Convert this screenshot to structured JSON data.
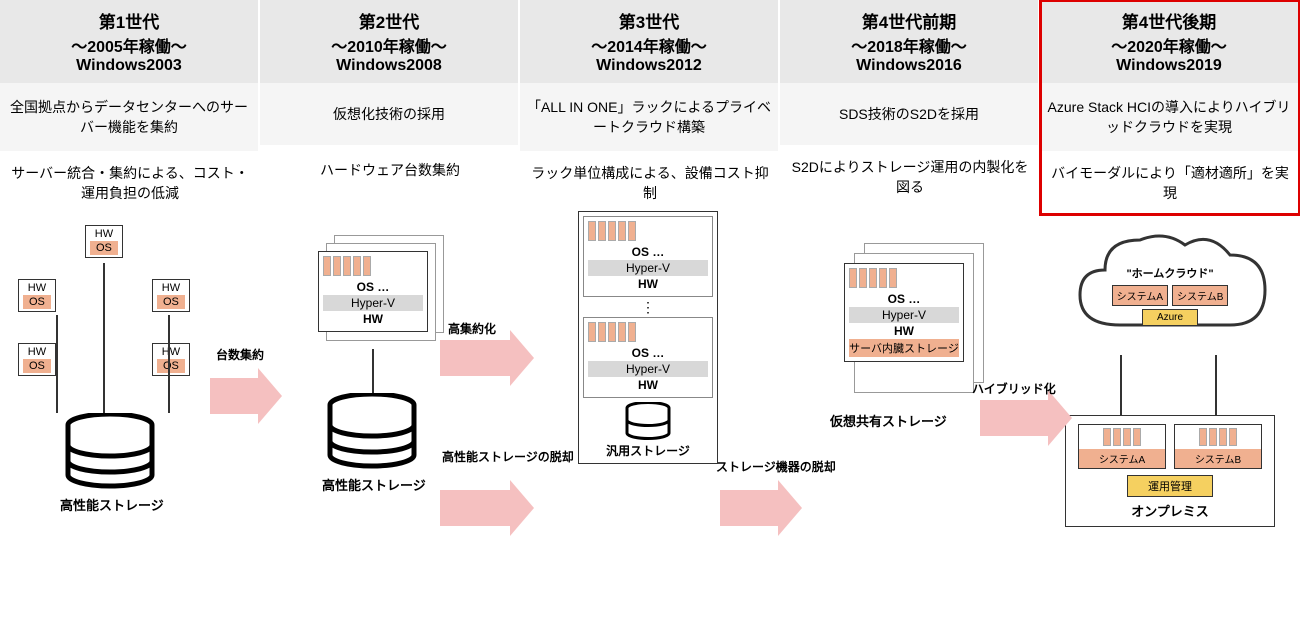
{
  "gens": [
    {
      "t1": "第1世代",
      "t2": "～2005年稼働～",
      "t3": "Windows2003",
      "d1": "全国拠点からデータセンターへのサーバー機能を集約",
      "d2": "サーバー統合・集約による、コスト・運用負担の低減"
    },
    {
      "t1": "第2世代",
      "t2": "～2010年稼働～",
      "t3": "Windows2008",
      "d1": "仮想化技術の採用",
      "d2": "ハードウェア台数集約"
    },
    {
      "t1": "第3世代",
      "t2": "～2014年稼働～",
      "t3": "Windows2012",
      "d1": "「ALL IN ONE」ラックによるプライベートクラウド構築",
      "d2": "ラック単位構成による、設備コスト抑制"
    },
    {
      "t1": "第4世代前期",
      "t2": "～2018年稼働～",
      "t3": "Windows2016",
      "d1": "SDS技術のS2Dを採用",
      "d2": "S2Dによりストレージ運用の内製化を図る"
    },
    {
      "t1": "第4世代後期",
      "t2": "～2020年稼働～",
      "t3": "Windows2019",
      "d1": "Azure Stack HCIの導入によりハイブリッドクラウドを実現",
      "d2": "バイモーダルにより「適材適所」を実現"
    }
  ],
  "labels": {
    "hw": "HW",
    "os": "OS",
    "hyperv": "Hyper-V",
    "dots": "…",
    "hiperf": "高性能ストレージ",
    "generic": "汎用ストレージ",
    "virtshared": "仮想共有ストレージ",
    "internal": "サーバ内臓ストレージ",
    "a1": "台数集約",
    "a2": "高集約化",
    "a3": "高性能ストレージの脱却",
    "a4": "ストレージ機器の脱却",
    "a5": "ハイブリッド化",
    "homecloud": "\"ホームクラウド\"",
    "sysA": "システムA",
    "sysB": "システムB",
    "azure": "Azure",
    "mgmt": "運用管理",
    "onprem": "オンプレミス"
  }
}
